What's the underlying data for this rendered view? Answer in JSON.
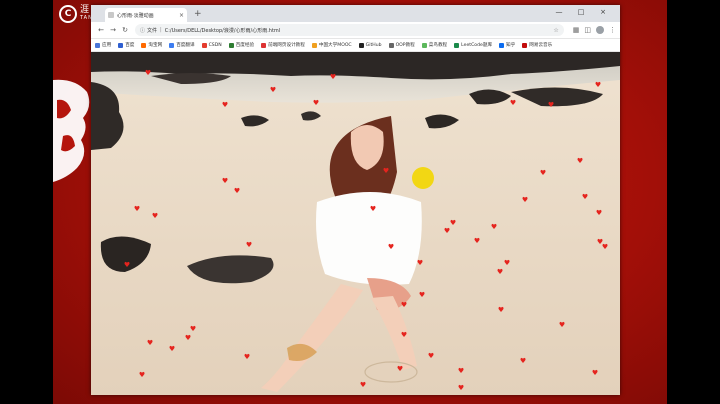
{
  "desktop": {
    "logo_glyph": "C",
    "logo_text_top": "涯",
    "logo_text_bottom": "TAN"
  },
  "browser": {
    "tab_title": "心形雨·淡雅动画",
    "tab_close": "×",
    "new_tab": "+",
    "window_controls": [
      "—",
      "□",
      "×"
    ],
    "address_prefix": "文件",
    "address_url": "C:/Users/DELL/Desktop/浪漫/心形雨/心形雨.html",
    "bookmarks": [
      {
        "label": "应用",
        "color": "#4a76d8"
      },
      {
        "label": "百度",
        "color": "#2f5fd0"
      },
      {
        "label": "淘宝网",
        "color": "#ff6a00"
      },
      {
        "label": "百度翻译",
        "color": "#3d7df0"
      },
      {
        "label": "CSDN",
        "color": "#e43c2e"
      },
      {
        "label": "百度经验",
        "color": "#2e7d32"
      },
      {
        "label": "前端网页设计教程",
        "color": "#d33"
      },
      {
        "label": "中国大学MOOC",
        "color": "#f0a020"
      },
      {
        "label": "GitHub",
        "color": "#222"
      },
      {
        "label": "OOP教程",
        "color": "#666"
      },
      {
        "label": "菜鸟教程",
        "color": "#5cb85c"
      },
      {
        "label": "LeetCode题库",
        "color": "#1b8a4b"
      },
      {
        "label": "知乎",
        "color": "#0b6cf0"
      },
      {
        "label": "网易云音乐",
        "color": "#c20c0c"
      }
    ]
  },
  "icons": {
    "back": "back-arrow-icon",
    "forward": "forward-arrow-icon",
    "reload": "reload-icon",
    "info": "info-icon",
    "star": "star-icon",
    "extension": "extension-icon",
    "menu": "menu-icon"
  },
  "animation": {
    "heart_glyph": "♥",
    "heart_color": "#e5241e"
  }
}
